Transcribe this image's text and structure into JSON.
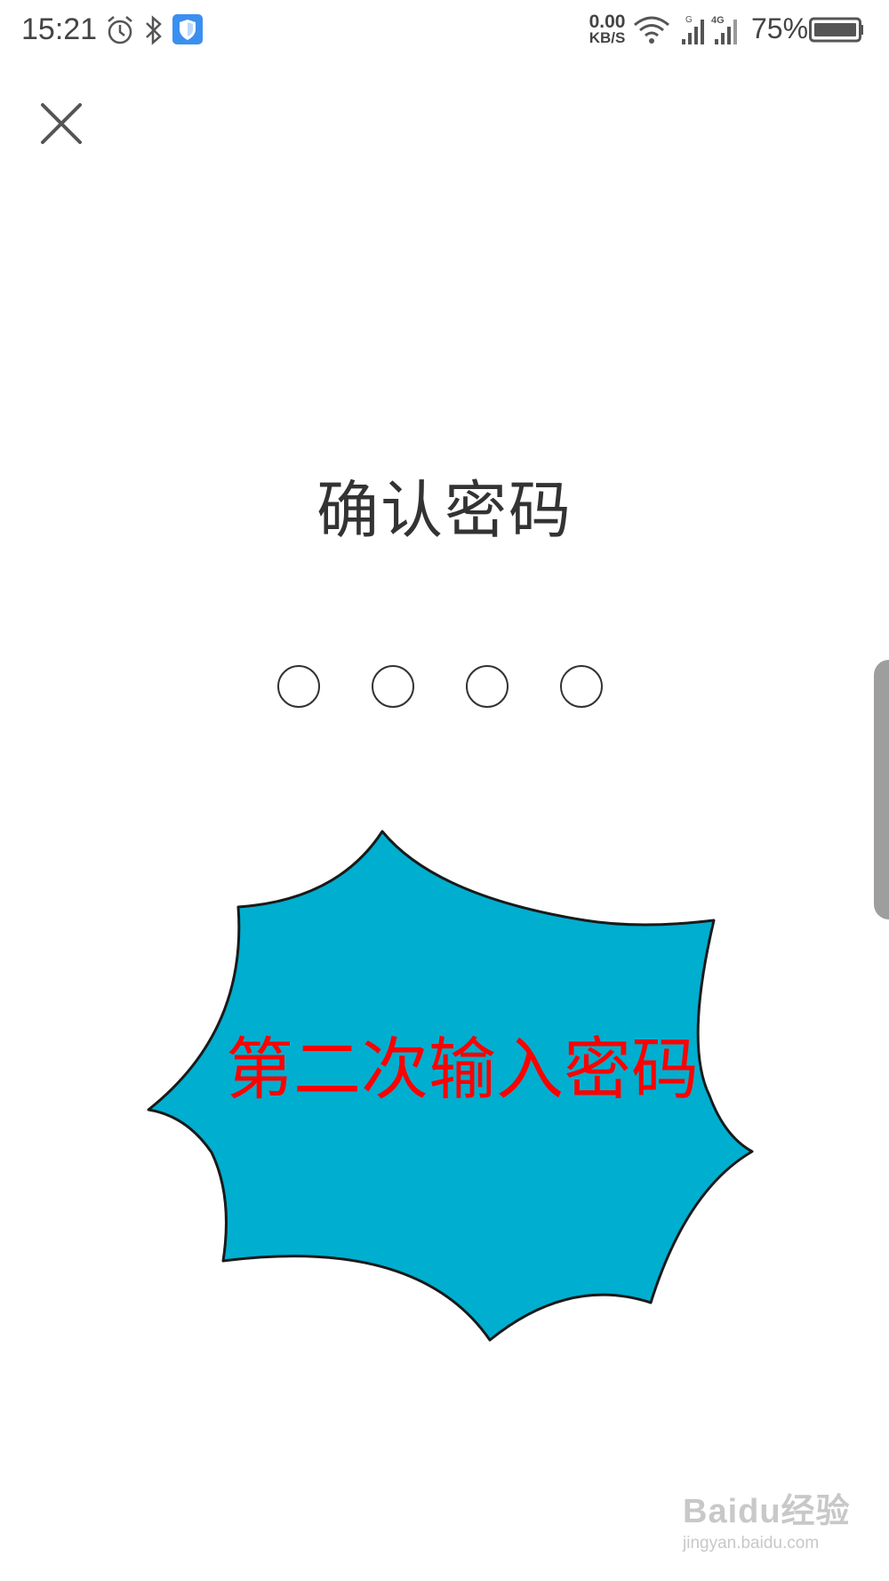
{
  "status_bar": {
    "time": "15:21",
    "net_speed_value": "0.00",
    "net_speed_unit": "KB/S",
    "battery": "75%",
    "icons": [
      "alarm-icon",
      "bluetooth-icon",
      "shield-icon",
      "wifi-icon",
      "signal-icon",
      "signal-4g-icon",
      "battery-icon"
    ]
  },
  "header": {
    "close_icon": "close-icon"
  },
  "main": {
    "title": "确认密码",
    "pin_length": 4,
    "pin_filled": 0
  },
  "annotation": {
    "text": "第二次输入密码",
    "fill": "#00aecf",
    "text_color": "#ff0000"
  },
  "watermark": {
    "logo": "Baidu经验",
    "url": "jingyan.baidu.com"
  },
  "colors": {
    "text": "#333333",
    "handle": "#9e9e9e"
  }
}
